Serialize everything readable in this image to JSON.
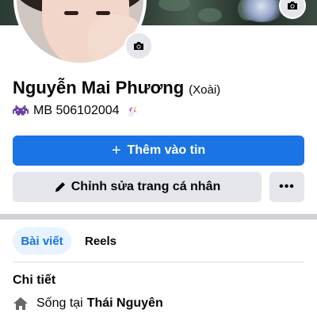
{
  "profile": {
    "name": "Nguyễn Mai Phương",
    "nickname": "(Xoài)",
    "bio_text": "MB 506102004",
    "bio_emoji_left": "space-invader-icon",
    "bio_emoji_right": "unicorn-icon"
  },
  "actions": {
    "add_story_label": "Thêm vào tin",
    "edit_profile_label": "Chỉnh sửa trang cá nhân",
    "more_label": "•••"
  },
  "tabs": [
    {
      "label": "Bài viết",
      "active": true
    },
    {
      "label": "Reels",
      "active": false
    }
  ],
  "details": {
    "title": "Chi tiết",
    "lives_in_prefix": "Sống tại",
    "lives_in_value": "Thái Nguyên"
  },
  "colors": {
    "primary": "#1b74e4",
    "secondary_button": "#e4e6eb",
    "active_tab_bg": "#e7f3ff",
    "text": "#050505"
  }
}
